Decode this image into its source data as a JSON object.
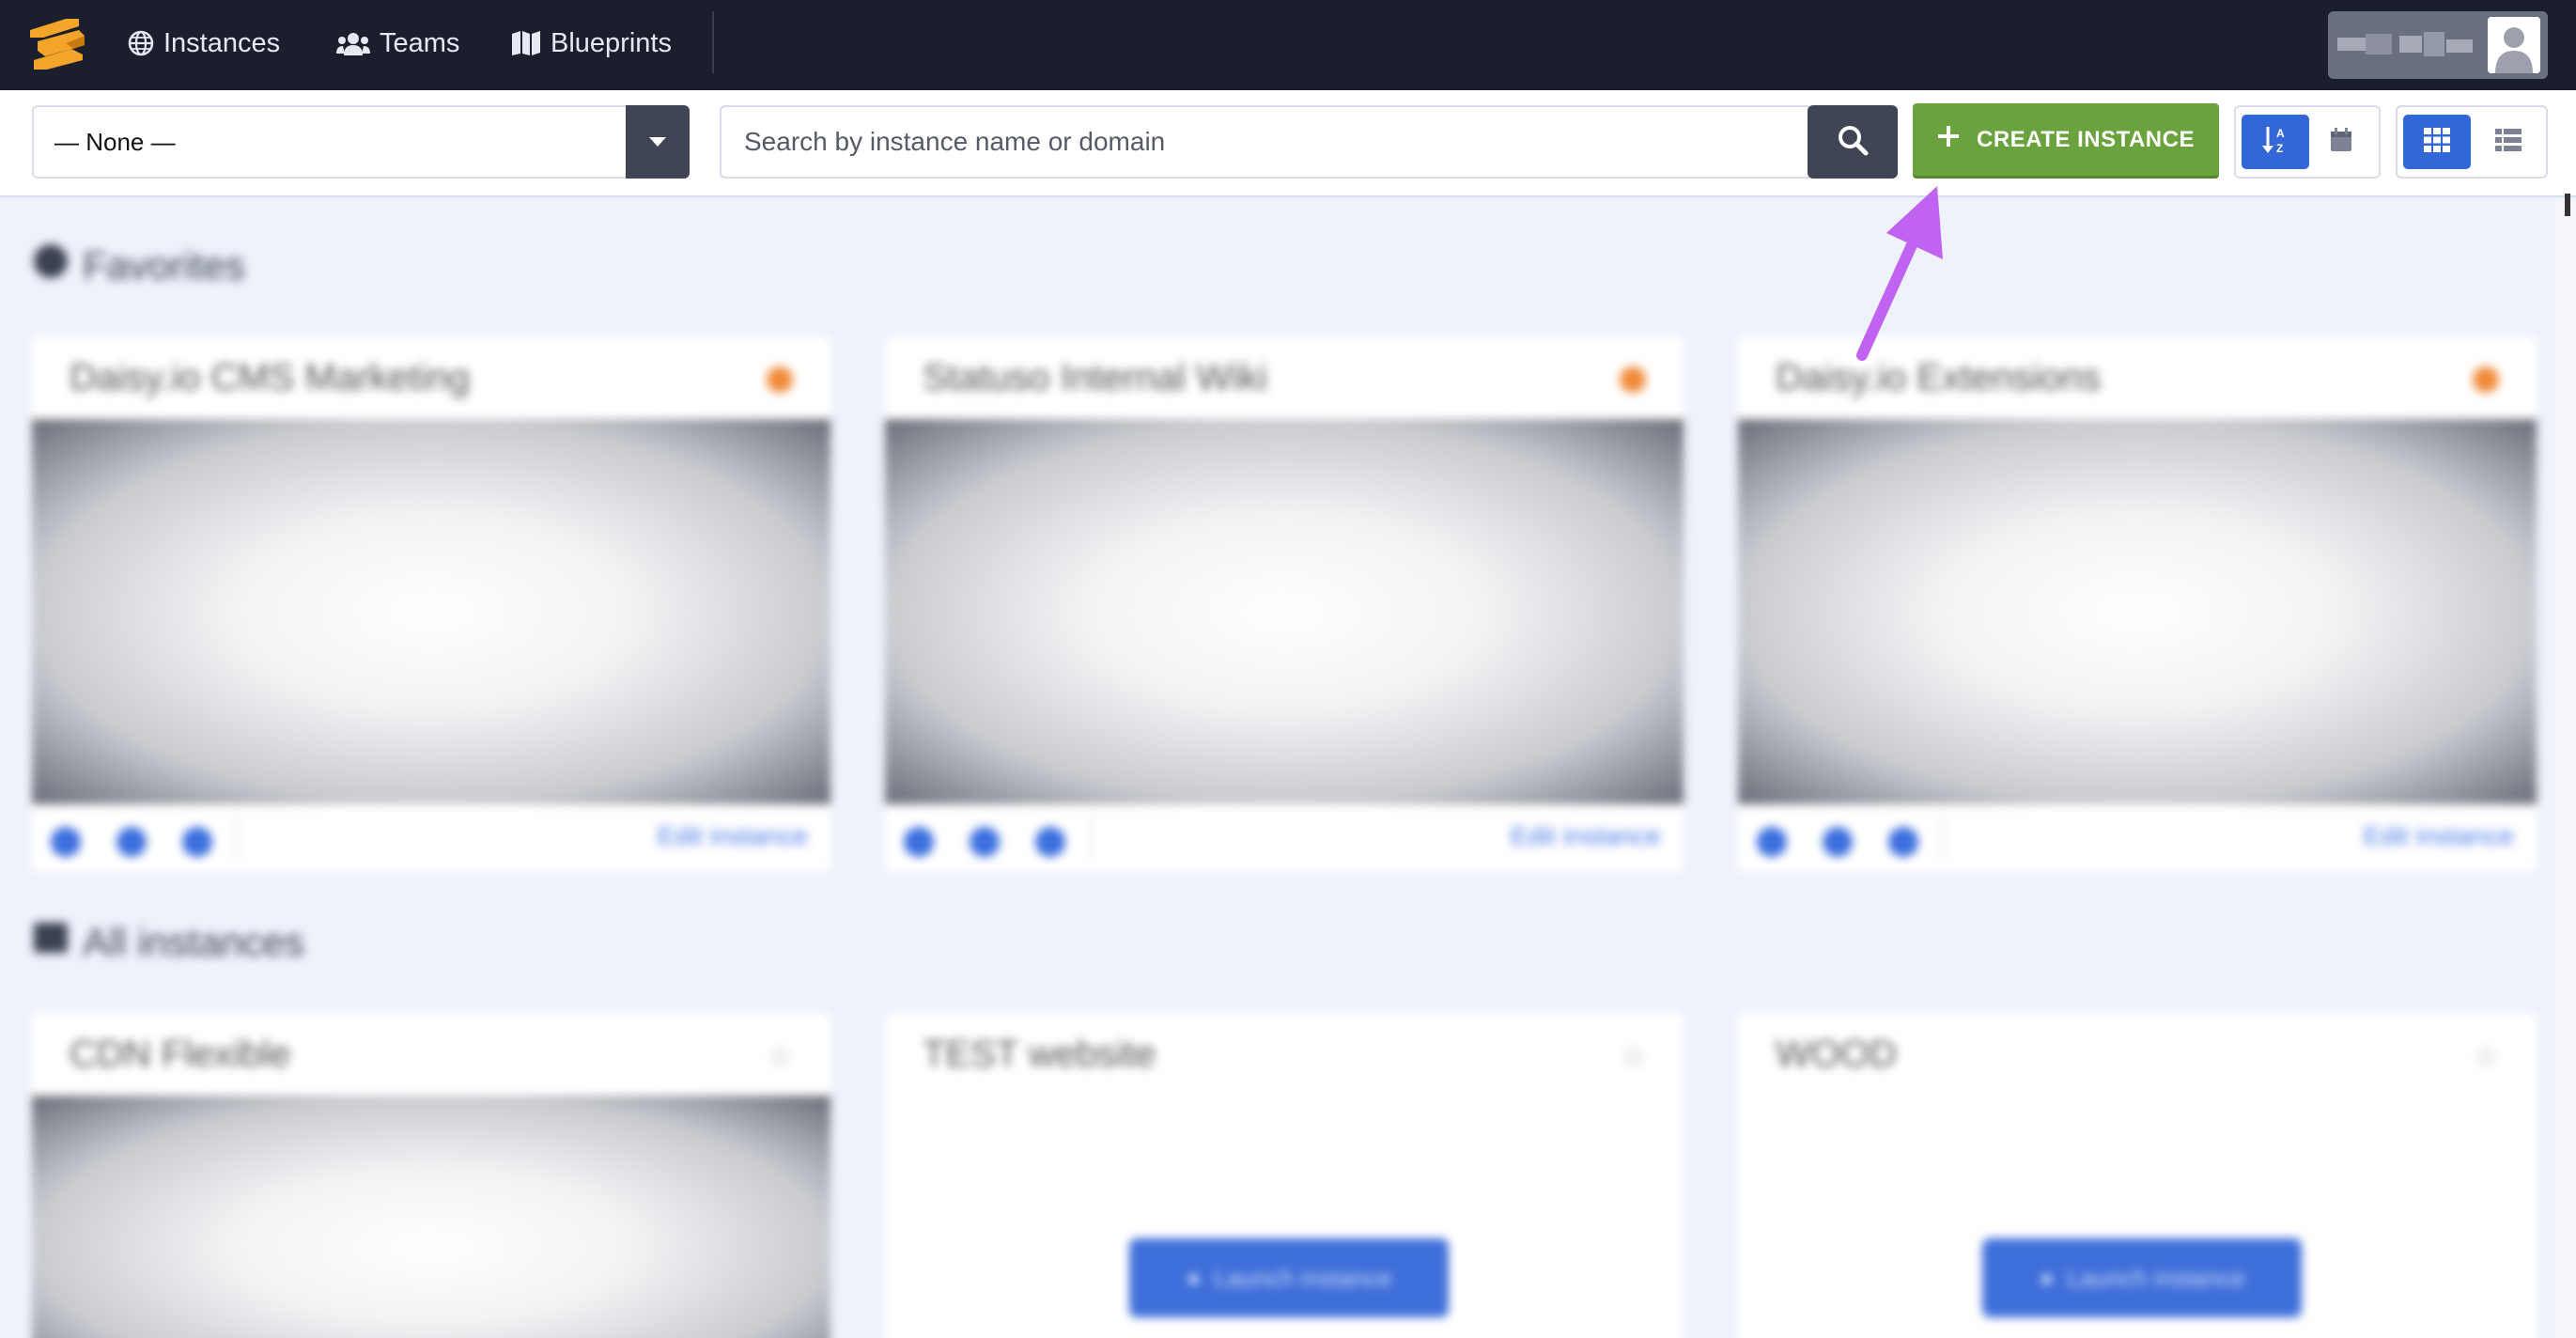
{
  "nav": {
    "items": [
      {
        "label": "Instances",
        "icon": "globe-icon"
      },
      {
        "label": "Teams",
        "icon": "users-icon"
      },
      {
        "label": "Blueprints",
        "icon": "map-icon"
      }
    ],
    "user_icon": "user-avatar-icon"
  },
  "toolbar": {
    "team_select_value": "— None —",
    "search_placeholder": "Search by instance name or domain",
    "create_label": "CREATE INSTANCE",
    "sort_group": [
      "sort-alpha-icon",
      "calendar-icon"
    ],
    "view_group": [
      "grid-view-icon",
      "list-view-icon"
    ]
  },
  "content": {
    "favorites_title": "Favorites",
    "favorites": [
      {
        "name": "Daisy.io CMS Marketing",
        "link": "Edit instance"
      },
      {
        "name": "Statuso Internal Wiki",
        "link": "Edit instance"
      },
      {
        "name": "Daisy.io Extensions",
        "link": "Edit instance"
      }
    ],
    "all_title": "All instances",
    "instances": [
      {
        "name": "CDN Flexible",
        "thumbnail": true
      },
      {
        "name": "TEST website",
        "thumbnail": false,
        "button": "Launch instance"
      },
      {
        "name": "WOOD",
        "thumbnail": false,
        "button": "Launch instance"
      }
    ]
  },
  "colors": {
    "nav_bg": "#1b1f2d",
    "create_green": "#6aa33d",
    "accent_blue": "#3366d6",
    "annotation_purple": "#c062f2",
    "favorite_orange": "#f08a3a"
  }
}
